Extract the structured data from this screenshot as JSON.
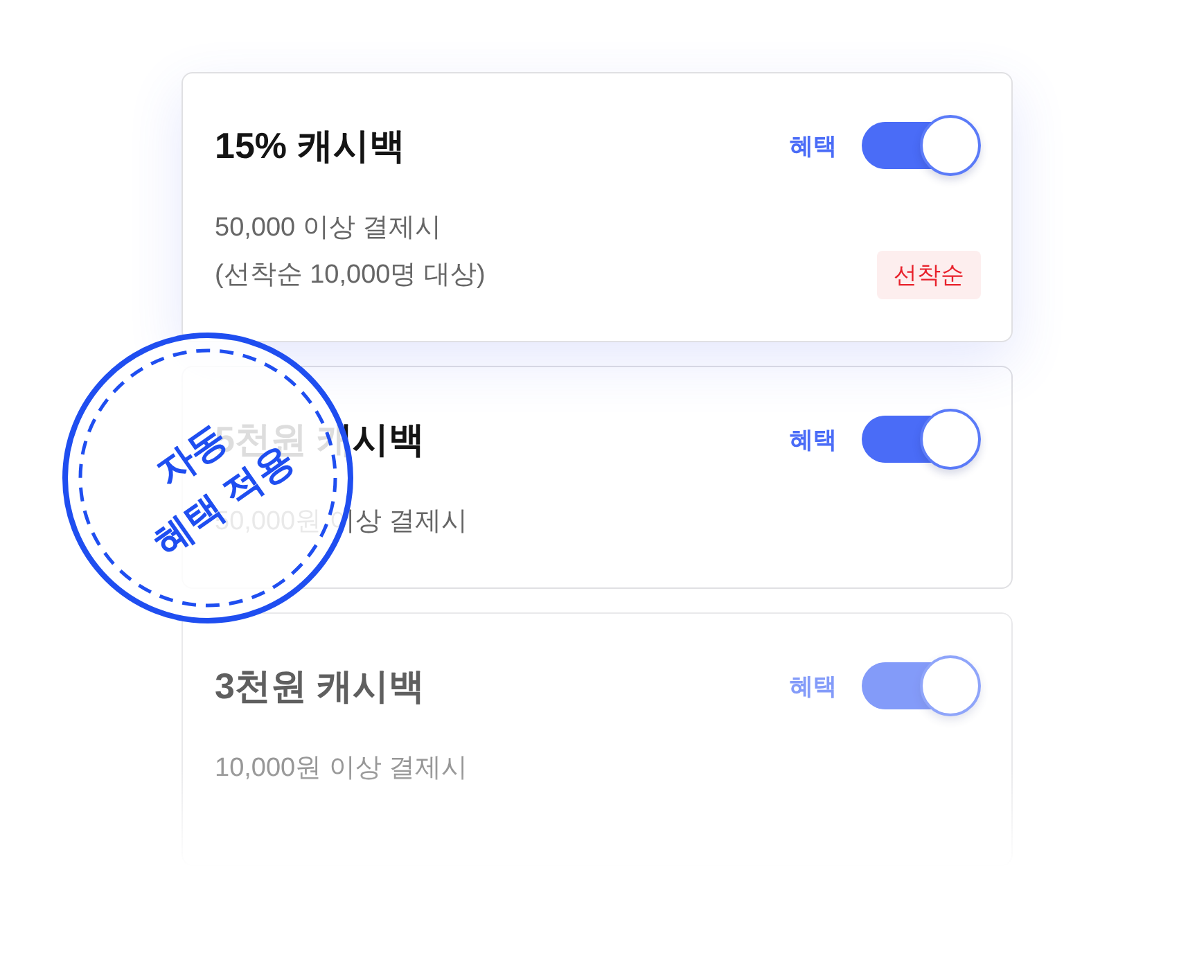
{
  "stamp": {
    "lines": [
      "자동",
      "혜택 적용"
    ]
  },
  "cards": [
    {
      "title": "15% 캐시백",
      "benefit_label": "혜택",
      "toggle_on": true,
      "conditions": [
        "50,000 이상 결제시",
        "(선착순 10,000명 대상)"
      ],
      "badge": "선착순",
      "elevated": true,
      "faded": false
    },
    {
      "title": "5천원 캐시백",
      "benefit_label": "혜택",
      "toggle_on": true,
      "conditions": [
        "50,000원 이상 결제시"
      ],
      "elevated": false,
      "faded": false
    },
    {
      "title": "3천원 캐시백",
      "benefit_label": "혜택",
      "toggle_on": true,
      "conditions": [
        "10,000원 이상 결제시"
      ],
      "elevated": false,
      "faded": true
    }
  ]
}
